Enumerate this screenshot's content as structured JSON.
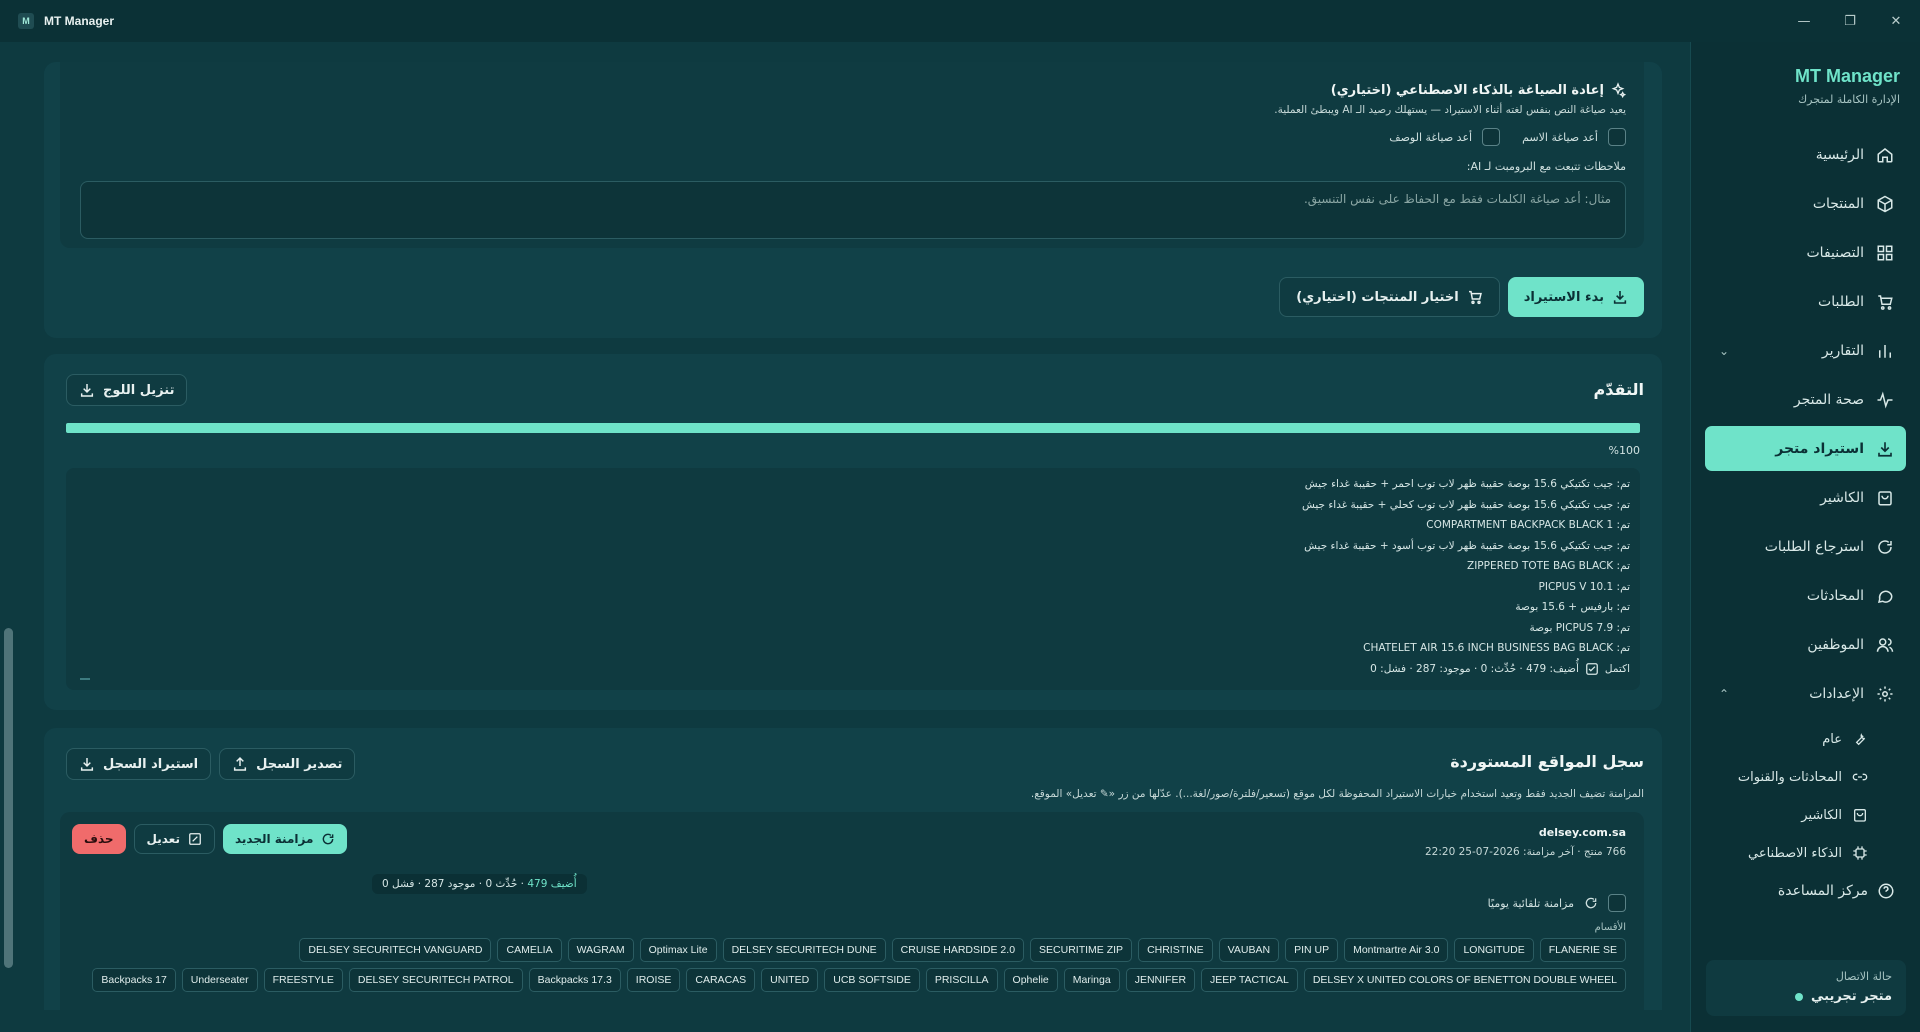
{
  "window": {
    "title": "MT Manager",
    "logo": "M"
  },
  "sidebar": {
    "brand": "MT Manager",
    "subtitle": "الإدارة الكاملة لمتجرك",
    "items": [
      {
        "label": "الرئيسية",
        "icon": "home-icon"
      },
      {
        "label": "المنتجات",
        "icon": "box-icon"
      },
      {
        "label": "التصنيفات",
        "icon": "grid-icon"
      },
      {
        "label": "الطلبات",
        "icon": "cart-icon"
      },
      {
        "label": "التقارير",
        "icon": "bar-chart-icon"
      },
      {
        "label": "صحة المتجر",
        "icon": "pulse-icon"
      },
      {
        "label": "استيراد متجر",
        "icon": "download-icon"
      },
      {
        "label": "الكاشير",
        "icon": "bag-icon"
      },
      {
        "label": "استرجاع الطلبات",
        "icon": "refresh-icon"
      },
      {
        "label": "المحادثات",
        "icon": "chat-icon"
      },
      {
        "label": "الموظفين",
        "icon": "users-icon"
      },
      {
        "label": "الإعدادات",
        "icon": "gear-icon"
      }
    ],
    "settings_sub": [
      {
        "label": "عام",
        "icon": "wrench-icon"
      },
      {
        "label": "المحادثات والقنوات",
        "icon": "link-icon"
      },
      {
        "label": "الكاشير",
        "icon": "bag-icon"
      },
      {
        "label": "الذكاء الاصطناعي",
        "icon": "chip-icon"
      },
      {
        "label": "مركز المساعدة",
        "icon": "help-icon"
      }
    ],
    "connection": {
      "label": "حالة الاتصال",
      "value": "متجر تجريبي"
    }
  },
  "ai": {
    "title": "إعادة الصياغة بالذكاء الاصطناعي (اختياري)",
    "desc": "يعيد صياغة النص بنفس لغته أثناء الاستيراد — يستهلك رصيد الـ AI ويبطئ العملية.",
    "rename_name": "أعد صياغة الاسم",
    "rename_desc": "أعد صياغة الوصف",
    "notes_label": "ملاحظات تتبعت مع البرومبت لـ AI:",
    "notes_placeholder": "مثال: أعد صياغة الكلمات فقط مع الحفاظ على نفس التنسيق."
  },
  "import_actions": {
    "start": "بدء الاستيراد",
    "choose": "اختيار المنتجات (اختياري)"
  },
  "progress": {
    "title": "التقدّم",
    "download_log": "تنزيل اللوج",
    "percent": "%100",
    "lines": [
      "تم: جيب تكتيكي 15.6 بوصة حقيبة ظهر لاب توب احمر + حقيبة غداء جيش",
      "تم: جيب تكتيكي 15.6 بوصة حقيبة ظهر لاب توب كحلي + حقيبة غداء جيش",
      "تم: 1 COMPARTMENT BACKPACK BLACK",
      "تم: جيب تكتيكي 15.6 بوصة حقيبة ظهر لاب توب أسود + حقيبة غداء جيش",
      "تم: ZIPPERED TOTE BAG BLACK",
      "تم: PICPUS V 10.1",
      "تم: بارفيس + 15.6 بوصة",
      "تم: PICPUS 7.9 بوصة",
      "تم: CHATELET AIR 15.6 INCH BUSINESS BAG BLACK"
    ],
    "done_label": "اكتمل",
    "done_stats": "أُضيف: 479 · حُدِّث: 0 · موجود: 287 · فشل: 0"
  },
  "history": {
    "title": "سجل المواقع المستوردة",
    "desc": "المزامنة تضيف الجديد فقط وتعيد استخدام خيارات الاستيراد المحفوظة لكل موقع (تسعير/فلترة/صور/لغة...). عدّلها من زر «✎ تعديل» الموقع.",
    "export": "تصدير السجل",
    "import": "استيراد السجل",
    "site": {
      "domain": "delsey.com.sa",
      "meta": "766 منتج · آخر مزامنة: 2026-07-25 22:20",
      "sync_new": "مزامنة الجديد",
      "edit": "تعديل",
      "delete": "حذف",
      "stat_added": "أُضيف 479",
      "stat_rest": " · حُدِّث 0 · موجود 287 · فشل 0",
      "auto_sync": "مزامنة تلقائية يوميًا",
      "cats_label": "الأقسام",
      "categories": [
        "FLANERIE SE",
        "LONGITUDE",
        "Montmartre Air 3.0",
        "PIN UP",
        "VAUBAN",
        "CHRISTINE",
        "SECURITIME ZIP",
        "CRUISE HARDSIDE 2.0",
        "DELSEY SECURITECH DUNE",
        "Optimax Lite",
        "WAGRAM",
        "CAMELIA",
        "DELSEY SECURITECH VANGUARD",
        "DELSEY X UNITED COLORS OF BENETTON DOUBLE WHEEL",
        "JEEP TACTICAL",
        "JENNIFER",
        "Maringa",
        "Ophelie",
        "PRISCILLA",
        "UCB SOFTSIDE",
        "UNITED",
        "CARACAS",
        "IROISE",
        "Backpacks 17.3",
        "DELSEY SECURITECH PATROL",
        "FREESTYLE",
        "Underseater",
        "Backpacks 17"
      ]
    }
  },
  "colors": {
    "accent": "#6fe3c9",
    "danger": "#f06b6b",
    "bg": "#0e3a40"
  }
}
